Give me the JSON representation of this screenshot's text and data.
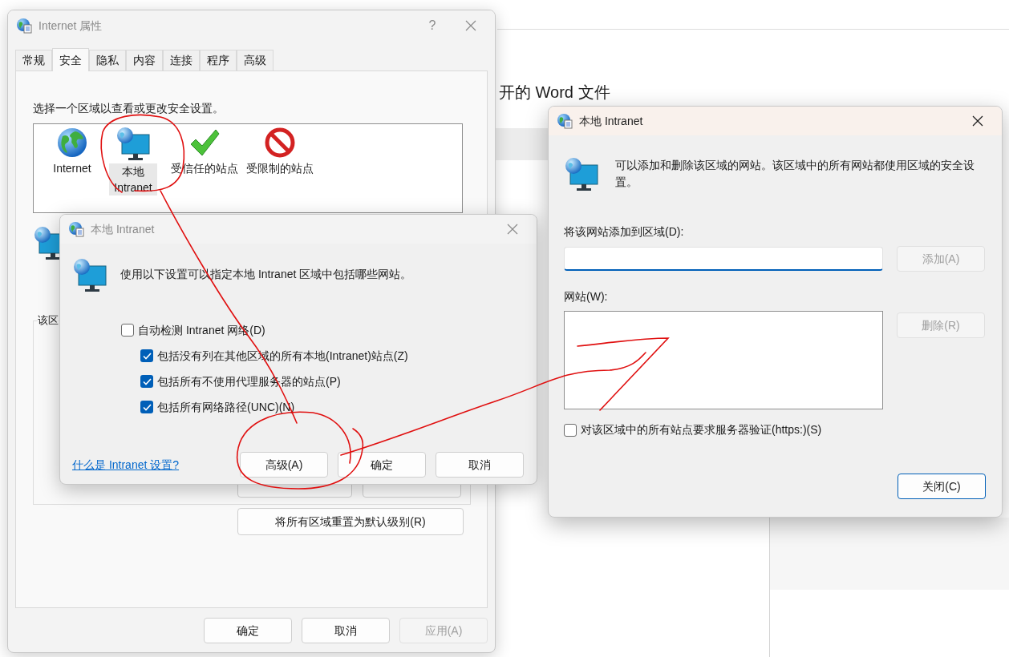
{
  "background_window": {
    "heading": "开的 Word 文件"
  },
  "properties_dialog": {
    "title": "Internet 属性",
    "active": false,
    "help": "?",
    "tabs": [
      {
        "label": "常规",
        "selected": false
      },
      {
        "label": "安全",
        "selected": true
      },
      {
        "label": "隐私",
        "selected": false
      },
      {
        "label": "内容",
        "selected": false
      },
      {
        "label": "连接",
        "selected": false
      },
      {
        "label": "程序",
        "selected": false
      },
      {
        "label": "高级",
        "selected": false
      }
    ],
    "zone_prompt": "选择一个区域以查看或更改安全设置。",
    "zones": [
      {
        "kind": "globe",
        "label": "Internet",
        "selected": false
      },
      {
        "kind": "intranet",
        "label": "本地 Intranet",
        "selected": true
      },
      {
        "kind": "trusted",
        "label": "受信任的站点",
        "selected": false
      },
      {
        "kind": "restricted",
        "label": "受限制的站点",
        "selected": false
      }
    ],
    "group_label": "该区",
    "reset_button": "将所有区域重置为默认级别(R)",
    "buttons": [
      {
        "label": "确定",
        "disabled": false
      },
      {
        "label": "取消",
        "disabled": false
      },
      {
        "label": "应用(A)",
        "disabled": true
      }
    ]
  },
  "intranet_dialog": {
    "title": "本地 Intranet",
    "active": false,
    "description": "使用以下设置可以指定本地 Intranet 区域中包括哪些网站。",
    "options": [
      {
        "label": "自动检测 Intranet 网络(D)",
        "checked": false,
        "children": [
          {
            "label": "包括没有列在其他区域的所有本地(Intranet)站点(Z)",
            "checked": true
          },
          {
            "label": "包括所有不使用代理服务器的站点(P)",
            "checked": true
          },
          {
            "label": "包括所有网络路径(UNC)(N)",
            "checked": true
          }
        ]
      }
    ],
    "link": "什么是 Intranet 设置?",
    "buttons": [
      {
        "label": "高级(A)"
      },
      {
        "label": "确定"
      },
      {
        "label": "取消"
      }
    ]
  },
  "sites_dialog": {
    "title": "本地 Intranet",
    "active": true,
    "description": "可以添加和删除该区域的网站。该区域中的所有网站都使用区域的安全设置。",
    "add_label": "将该网站添加到区域(D):",
    "add_button": {
      "label": "添加(A)",
      "disabled": true
    },
    "list_label": "网站(W):",
    "remove_button": {
      "label": "删除(R)",
      "disabled": true
    },
    "https_option": {
      "label": "对该区域中的所有站点要求服务器验证(https:)(S)",
      "checked": false
    },
    "close_button": {
      "label": "关闭(C)",
      "default": true
    }
  }
}
